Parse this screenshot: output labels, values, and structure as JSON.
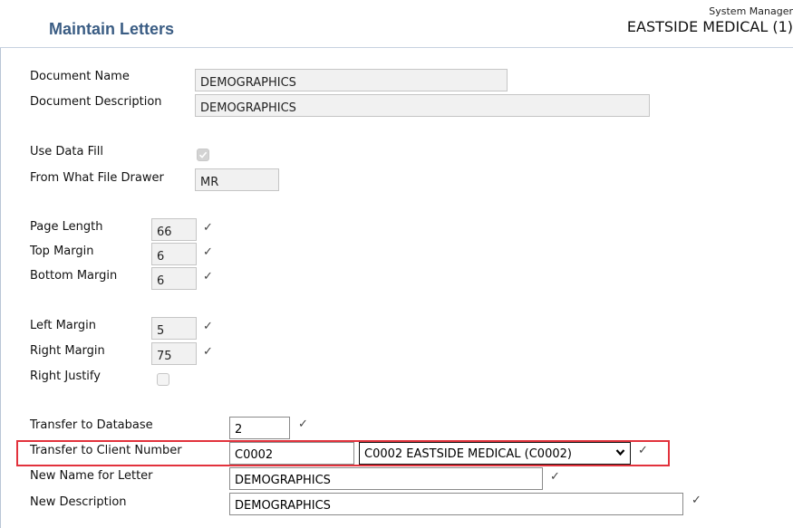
{
  "header": {
    "title": "Maintain Letters",
    "system_line": "System Manager",
    "company": "EASTSIDE MEDICAL (1)"
  },
  "form": {
    "document_name": {
      "label": "Document Name",
      "value": "DEMOGRAPHICS"
    },
    "document_description": {
      "label": "Document Description",
      "value": "DEMOGRAPHICS"
    },
    "use_data_fill": {
      "label": "Use Data Fill",
      "checked": true
    },
    "from_file_drawer": {
      "label": "From What File Drawer",
      "value": "MR"
    },
    "page_length": {
      "label": "Page Length",
      "value": "66"
    },
    "top_margin": {
      "label": "Top Margin",
      "value": "6"
    },
    "bottom_margin": {
      "label": "Bottom Margin",
      "value": "6"
    },
    "left_margin": {
      "label": "Left Margin",
      "value": "5"
    },
    "right_margin": {
      "label": "Right Margin",
      "value": "75"
    },
    "right_justify": {
      "label": "Right Justify",
      "checked": false
    },
    "transfer_database": {
      "label": "Transfer to Database",
      "value": "2"
    },
    "transfer_client": {
      "label": "Transfer to Client Number",
      "value": "C0002",
      "selected_option": "C0002 EASTSIDE MEDICAL (C0002)"
    },
    "new_name": {
      "label": "New Name for Letter",
      "value": "DEMOGRAPHICS"
    },
    "new_description": {
      "label": "New Description",
      "value": "DEMOGRAPHICS"
    }
  },
  "icons": {
    "valid": "check-mark-icon",
    "dropdown": "chevron-down-icon"
  },
  "colors": {
    "title": "#3b5d84",
    "highlight": "#e2323c"
  }
}
